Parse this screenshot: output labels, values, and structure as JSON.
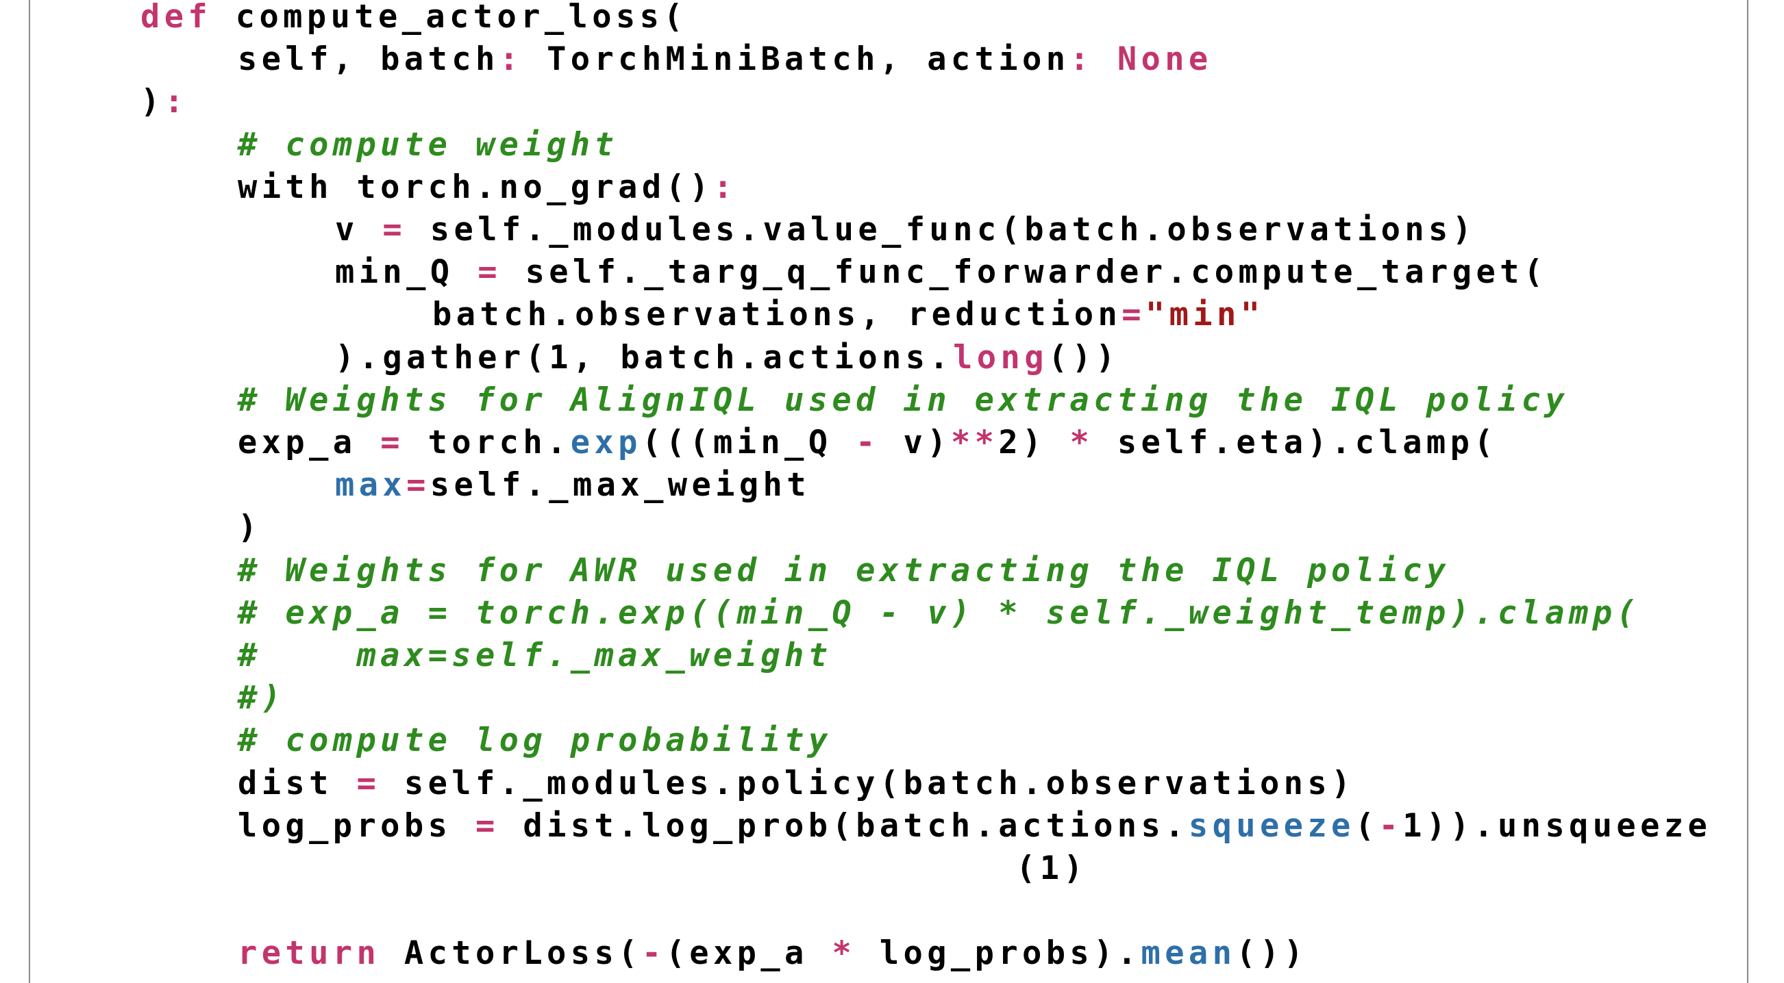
{
  "code": {
    "language": "python",
    "colors": {
      "keyword": "#c2356e",
      "operator": "#c2356e",
      "comment": "#2e8b1e",
      "builtin": "#2f6fa8",
      "string": "#a01818",
      "text": "#000000"
    },
    "lines": [
      {
        "indent": 0,
        "tokens": [
          {
            "t": "def",
            "c": "kw"
          },
          {
            "t": " compute_actor_loss(",
            "c": ""
          }
        ]
      },
      {
        "indent": 1,
        "tokens": [
          {
            "t": "self, batch",
            "c": ""
          },
          {
            "t": ":",
            "c": "op"
          },
          {
            "t": " TorchMiniBatch, action",
            "c": ""
          },
          {
            "t": ":",
            "c": "op"
          },
          {
            "t": " ",
            "c": ""
          },
          {
            "t": "None",
            "c": "kw"
          }
        ]
      },
      {
        "indent": 0,
        "tokens": [
          {
            "t": ")",
            "c": ""
          },
          {
            "t": ":",
            "c": "op"
          }
        ]
      },
      {
        "indent": 1,
        "tokens": [
          {
            "t": "# compute weight",
            "c": "cm"
          }
        ]
      },
      {
        "indent": 1,
        "tokens": [
          {
            "t": "with torch.no_grad()",
            "c": ""
          },
          {
            "t": ":",
            "c": "op"
          }
        ]
      },
      {
        "indent": 2,
        "tokens": [
          {
            "t": "v ",
            "c": ""
          },
          {
            "t": "=",
            "c": "op"
          },
          {
            "t": " self._modules.value_func(batch.observations)",
            "c": ""
          }
        ]
      },
      {
        "indent": 2,
        "tokens": [
          {
            "t": "min_Q ",
            "c": ""
          },
          {
            "t": "=",
            "c": "op"
          },
          {
            "t": " self._targ_q_func_forwarder.compute_target(",
            "c": ""
          }
        ]
      },
      {
        "indent": 3,
        "tokens": [
          {
            "t": "batch.observations, reduction",
            "c": ""
          },
          {
            "t": "=",
            "c": "op"
          },
          {
            "t": "\"min\"",
            "c": "str"
          }
        ]
      },
      {
        "indent": 2,
        "tokens": [
          {
            "t": ").gather(1, batch.actions.",
            "c": ""
          },
          {
            "t": "long",
            "c": "kw"
          },
          {
            "t": "())",
            "c": ""
          }
        ]
      },
      {
        "indent": 1,
        "tokens": [
          {
            "t": "# Weights for AlignIQL used in extracting the IQL policy",
            "c": "cm"
          }
        ]
      },
      {
        "indent": 1,
        "tokens": [
          {
            "t": "exp_a ",
            "c": ""
          },
          {
            "t": "=",
            "c": "op"
          },
          {
            "t": " torch.",
            "c": ""
          },
          {
            "t": "exp",
            "c": "fn"
          },
          {
            "t": "(((min_Q ",
            "c": ""
          },
          {
            "t": "-",
            "c": "op"
          },
          {
            "t": " v)",
            "c": ""
          },
          {
            "t": "**",
            "c": "op"
          },
          {
            "t": "2) ",
            "c": ""
          },
          {
            "t": "*",
            "c": "op"
          },
          {
            "t": " self.eta).clamp(",
            "c": ""
          }
        ]
      },
      {
        "indent": 2,
        "tokens": [
          {
            "t": "max",
            "c": "fn"
          },
          {
            "t": "=",
            "c": "op"
          },
          {
            "t": "self._max_weight",
            "c": ""
          }
        ]
      },
      {
        "indent": 1,
        "tokens": [
          {
            "t": ")",
            "c": ""
          }
        ]
      },
      {
        "indent": 1,
        "tokens": [
          {
            "t": "# Weights for AWR used in extracting the IQL policy",
            "c": "cm"
          }
        ]
      },
      {
        "indent": 1,
        "tokens": [
          {
            "t": "# exp_a = torch.exp((min_Q - v) * self._weight_temp).clamp(",
            "c": "cm"
          }
        ]
      },
      {
        "indent": 1,
        "tokens": [
          {
            "t": "#    max=self._max_weight",
            "c": "cm"
          }
        ]
      },
      {
        "indent": 1,
        "tokens": [
          {
            "t": "#)",
            "c": "cm"
          }
        ]
      },
      {
        "indent": 1,
        "tokens": [
          {
            "t": "# compute log probability",
            "c": "cm"
          }
        ]
      },
      {
        "indent": 1,
        "tokens": [
          {
            "t": "dist ",
            "c": ""
          },
          {
            "t": "=",
            "c": "op"
          },
          {
            "t": " self._modules.policy(batch.observations)",
            "c": ""
          }
        ]
      },
      {
        "indent": 1,
        "tokens": [
          {
            "t": "log_probs ",
            "c": ""
          },
          {
            "t": "=",
            "c": "op"
          },
          {
            "t": " dist.log_prob(batch.actions.",
            "c": ""
          },
          {
            "t": "squeeze",
            "c": "fn"
          },
          {
            "t": "(",
            "c": ""
          },
          {
            "t": "-",
            "c": "op"
          },
          {
            "t": "1)).unsqueeze",
            "c": ""
          }
        ]
      },
      {
        "indent": 9,
        "tokens": [
          {
            "t": "(1)",
            "c": ""
          }
        ]
      },
      {
        "indent": 0,
        "tokens": []
      },
      {
        "indent": 1,
        "tokens": [
          {
            "t": "return",
            "c": "kw"
          },
          {
            "t": " ActorLoss(",
            "c": ""
          },
          {
            "t": "-",
            "c": "op"
          },
          {
            "t": "(exp_a ",
            "c": ""
          },
          {
            "t": "*",
            "c": "op"
          },
          {
            "t": " log_probs).",
            "c": ""
          },
          {
            "t": "mean",
            "c": "fn"
          },
          {
            "t": "())",
            "c": ""
          }
        ]
      }
    ]
  }
}
